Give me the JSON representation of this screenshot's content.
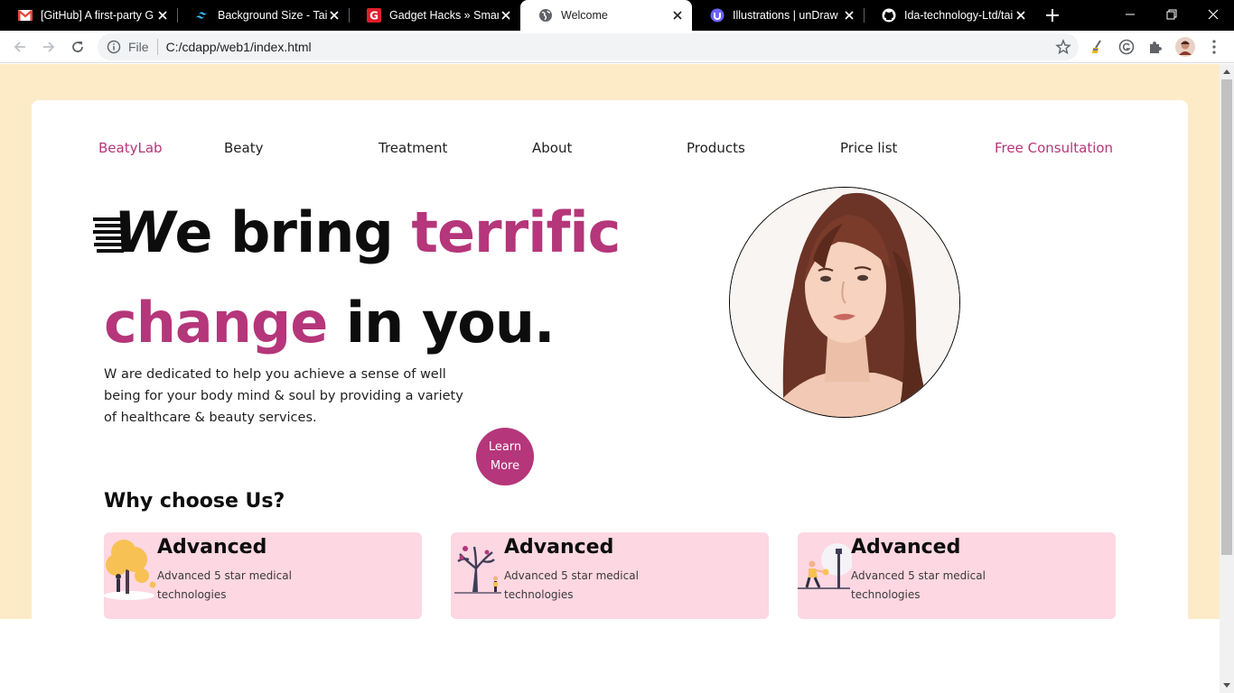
{
  "browser": {
    "tabs": [
      {
        "title": "[GitHub] A first-party G",
        "icon": "gmail-icon"
      },
      {
        "title": "Background Size - Tailw",
        "icon": "tailwind-icon"
      },
      {
        "title": "Gadget Hacks » Smartp",
        "icon": "gadget-hacks-icon"
      },
      {
        "title": "Welcome",
        "icon": "globe-icon",
        "active": true
      },
      {
        "title": "Illustrations | unDraw",
        "icon": "undraw-icon"
      },
      {
        "title": "Ida-technology-Ltd/tail",
        "icon": "github-icon"
      }
    ],
    "address": {
      "scheme_label": "File",
      "url": "C:/cdapp/web1/index.html"
    }
  },
  "page": {
    "nav": {
      "brand": "BeatyLab",
      "links": [
        "Beaty",
        "Treatment",
        "About",
        "Products",
        "Price list"
      ],
      "cta": "Free Consultation"
    },
    "hero": {
      "line1_rest": "e bring",
      "line1_accent": "terrific",
      "line2_accent": "change",
      "line2_rest": "in you.",
      "lead": "W are dedicated to help you achieve a sense of well being for your body mind & soul by providing a variety of healthcare & beauty services.",
      "button_line1": "Learn",
      "button_line2": "More"
    },
    "why": {
      "heading": "Why choose Us?",
      "features": [
        {
          "title": "Advanced",
          "desc": "Advanced 5 star medical technologies"
        },
        {
          "title": "Advanced",
          "desc": "Advanced 5 star medical technologies"
        },
        {
          "title": "Advanced",
          "desc": "Advanced 5 star medical technologies"
        }
      ]
    }
  },
  "colors": {
    "accent": "#b5367a",
    "page_background": "#fdebc8",
    "feature_card": "#fdd7e2",
    "chrome_tabstrip": "#000000"
  }
}
